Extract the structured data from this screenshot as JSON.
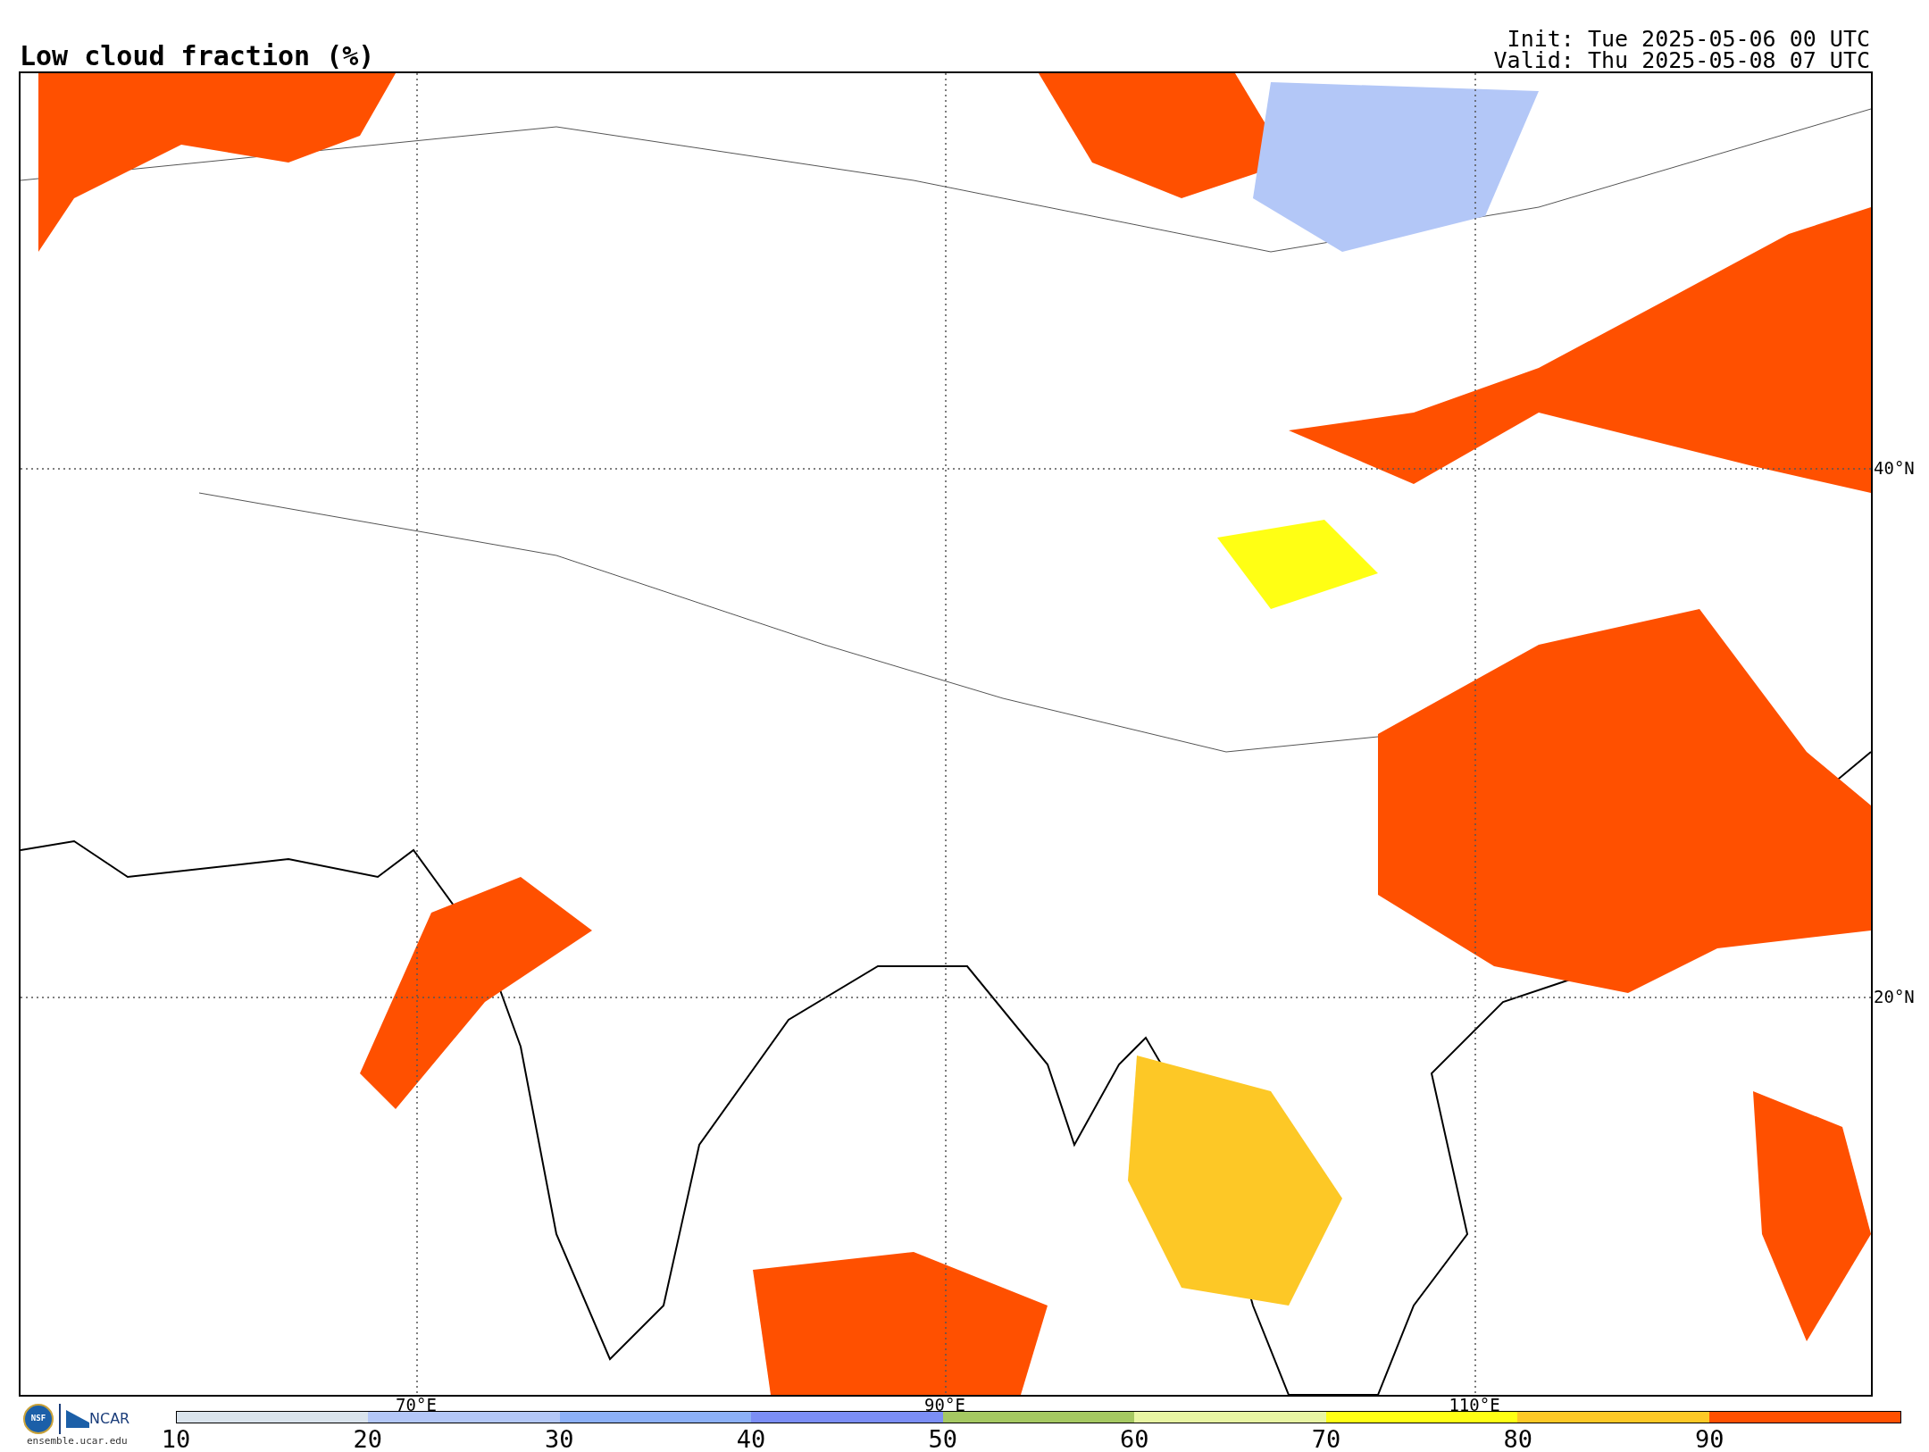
{
  "title": "Low cloud fraction (%)",
  "init": "Init: Tue 2025-05-06 00 UTC",
  "valid": "Valid: Thu 2025-05-08 07 UTC",
  "map": {
    "lat_labels": [
      "40°N",
      "20°N"
    ],
    "lon_labels": [
      "70°E",
      "90°E",
      "110°E"
    ]
  },
  "logo": {
    "nsf": "NSF",
    "ncar": "NCAR",
    "url": "ensemble.ucar.edu"
  },
  "colorbar": {
    "bins": [
      {
        "color": "#d9e3ec"
      },
      {
        "color": "#b3c7f7"
      },
      {
        "color": "#8cb0f7"
      },
      {
        "color": "#7b8ef5"
      },
      {
        "color": "#a5c862"
      },
      {
        "color": "#e8f5a3"
      },
      {
        "color": "#ffff14"
      },
      {
        "color": "#fdc826"
      },
      {
        "color": "#ff5000"
      }
    ],
    "ticks": [
      "10",
      "20",
      "30",
      "40",
      "50",
      "60",
      "70",
      "80",
      "90"
    ]
  }
}
